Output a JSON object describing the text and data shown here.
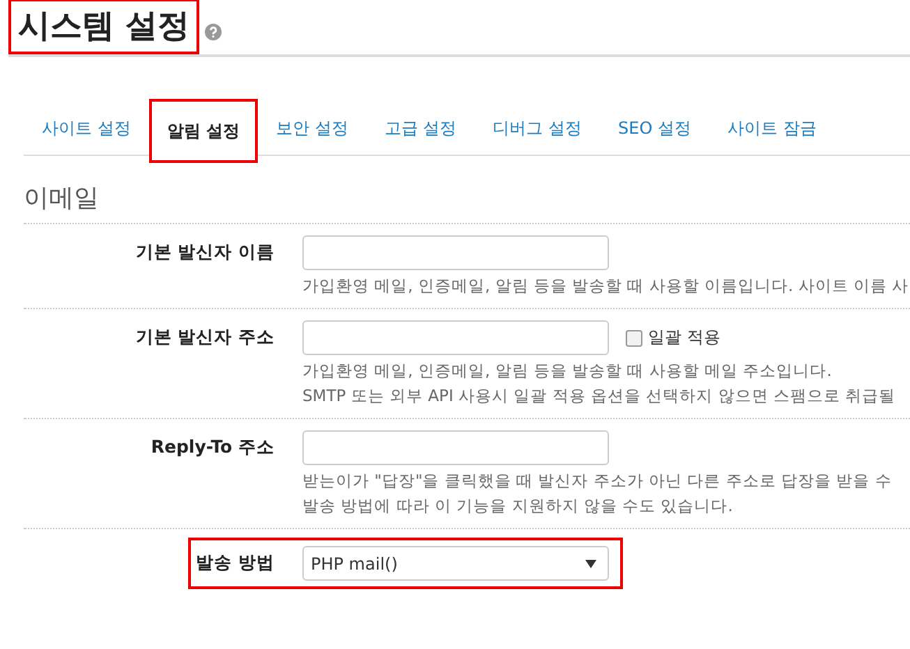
{
  "page": {
    "title": "시스템 설정",
    "highlighted": true
  },
  "tabs": [
    {
      "label": "사이트 설정",
      "selected": false
    },
    {
      "label": "알림 설정",
      "selected": true
    },
    {
      "label": "보안 설정",
      "selected": false
    },
    {
      "label": "고급 설정",
      "selected": false
    },
    {
      "label": "디버그 설정",
      "selected": false
    },
    {
      "label": "SEO 설정",
      "selected": false
    },
    {
      "label": "사이트 잠금",
      "selected": false
    }
  ],
  "section": {
    "title": "이메일"
  },
  "rows": [
    {
      "kind": "text",
      "label": "기본 발신자 이름",
      "help": [
        "가입환영 메일, 인증메일, 알림 등을 발송할 때 사용할 이름입니다. 사이트 이름 사"
      ]
    },
    {
      "kind": "text",
      "label": "기본 발신자 주소",
      "checkbox": {
        "label": "일괄 적용",
        "checked": false
      },
      "help": [
        "가입환영 메일, 인증메일, 알림 등을 발송할 때 사용할 메일 주소입니다.",
        "SMTP 또는 외부 API 사용시 일괄 적용 옵션을 선택하지 않으면 스팸으로 취급될"
      ]
    },
    {
      "kind": "text",
      "label": "Reply-To 주소",
      "help": [
        "받는이가 \"답장\"을 클릭했을 때 발신자 주소가 아닌 다른 주소로 답장을 받을 수",
        "발송 방법에 따라 이 기능을 지원하지 않을 수도 있습니다."
      ]
    },
    {
      "kind": "select",
      "label": "발송 방법",
      "value": "PHP mail()",
      "highlighted": true
    }
  ]
}
